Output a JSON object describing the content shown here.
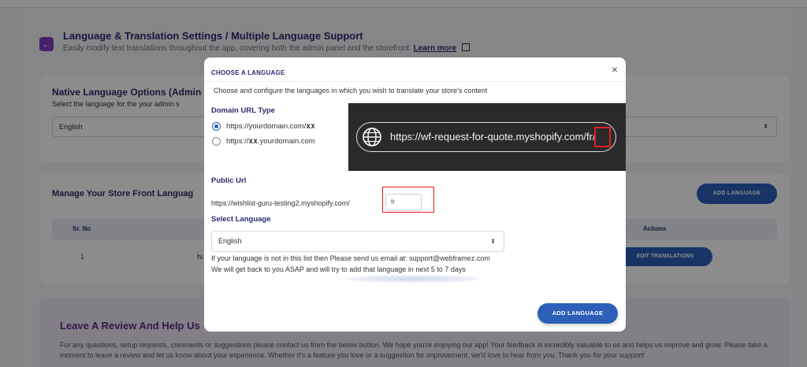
{
  "header": {
    "title": "Language & Translation Settings / Multiple Language Support",
    "subtitle": "Easily modify text translations throughout the app, covering both the admin panel and the storefront.",
    "learn_more": "Learn more"
  },
  "native": {
    "title": "Native Language Options (Admin",
    "subtitle": "Select the language for the your admin s",
    "selected": "English"
  },
  "store": {
    "title": "Manage Your Store Front Languag",
    "add_label": "ADD LANGUAGE",
    "columns": [
      "Sr. No",
      "Actions"
    ],
    "row": {
      "sr": "1",
      "partial": "hi",
      "edit_label": "EDIT TRANSLATIONS"
    }
  },
  "review": {
    "title": "Leave A Review And Help Us",
    "paragraph": "For any questions, setup requests, comments or suggestions please contact us from the below button. We hope you're enjoying our app! Your feedback is incredibly valuable to us and helps us improve and grow. Please take a moment to leave a review and let us know about your experience. Whether it's a feature you love or a suggestion for improvement, we'd love to hear from you. Thank you for your support!"
  },
  "modal": {
    "heading": "CHOOSE A LANGUAGE",
    "close": "×",
    "description": "Choose and configure the languages in which you wish to translate your store's content",
    "domain_title": "Domain URL Type",
    "option1_prefix": "https://yourdomain.com/",
    "option1_code": "xx",
    "option2_prefix": "https://",
    "option2_code": "xx",
    "option2_suffix": ".yourdomain.com",
    "banner_url": "https://wf-request-for-quote.myshopify.com/fr/",
    "public_title": "Public Url",
    "public_url": "https://wishlist-guru-testing2.myshopify.com/",
    "public_code": "fr",
    "select_title": "Select Language",
    "select_value": "English",
    "note1": "If your language is not in this list then Please send us email at: support@webframez.com",
    "note2": "We will get back to you ASAP and will try to add that language in next 5 to 7 days",
    "add_label": "ADD LANGUAGE"
  }
}
